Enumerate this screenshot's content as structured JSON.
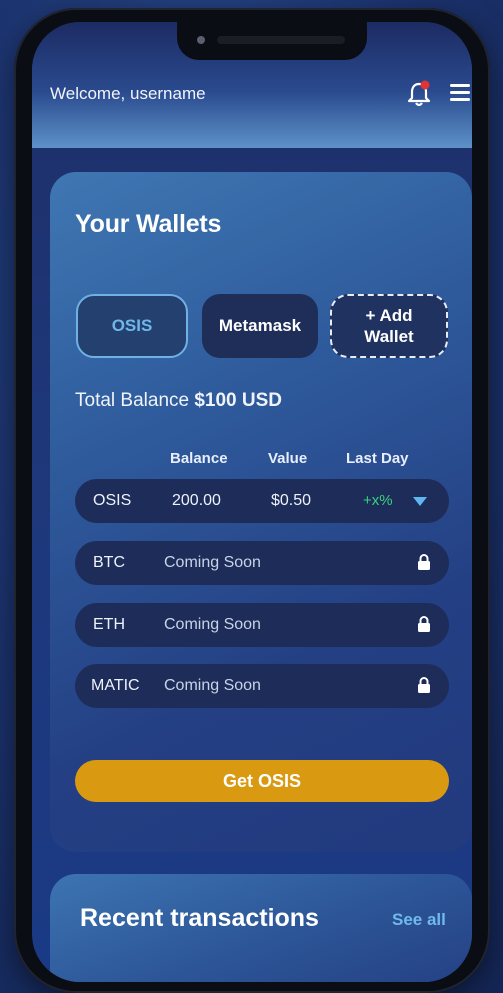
{
  "header": {
    "welcome": "Welcome, username"
  },
  "wallets": {
    "title": "Your Wallets",
    "tabs": [
      {
        "label": "OSIS",
        "selected": true
      },
      {
        "label": "Metamask",
        "selected": false
      },
      {
        "label": "+ Add\nWallet",
        "selected": false
      }
    ],
    "total_label": "Total Balance",
    "total_value": "$100 USD",
    "columns": [
      "Balance",
      "Value",
      "Last Day"
    ],
    "rows": [
      {
        "coin": "OSIS",
        "balance": "200.00",
        "value": "$0.50",
        "change": "+x%"
      },
      {
        "coin": "BTC",
        "status": "Coming Soon"
      },
      {
        "coin": "ETH",
        "status": "Coming Soon"
      },
      {
        "coin": "MATIC",
        "status": "Coming Soon"
      }
    ],
    "cta": "Get OSIS"
  },
  "recent": {
    "title": "Recent transactions",
    "see_all": "See all"
  },
  "colors": {
    "accent": "#d99a12",
    "positive": "#37d37d",
    "highlight": "#6fb7ea",
    "notification": "#e23434"
  },
  "icons": {
    "bell": "bell-icon",
    "menu": "hamburger-menu-icon",
    "lock": "lock-icon",
    "expand": "triangle-down-icon"
  }
}
